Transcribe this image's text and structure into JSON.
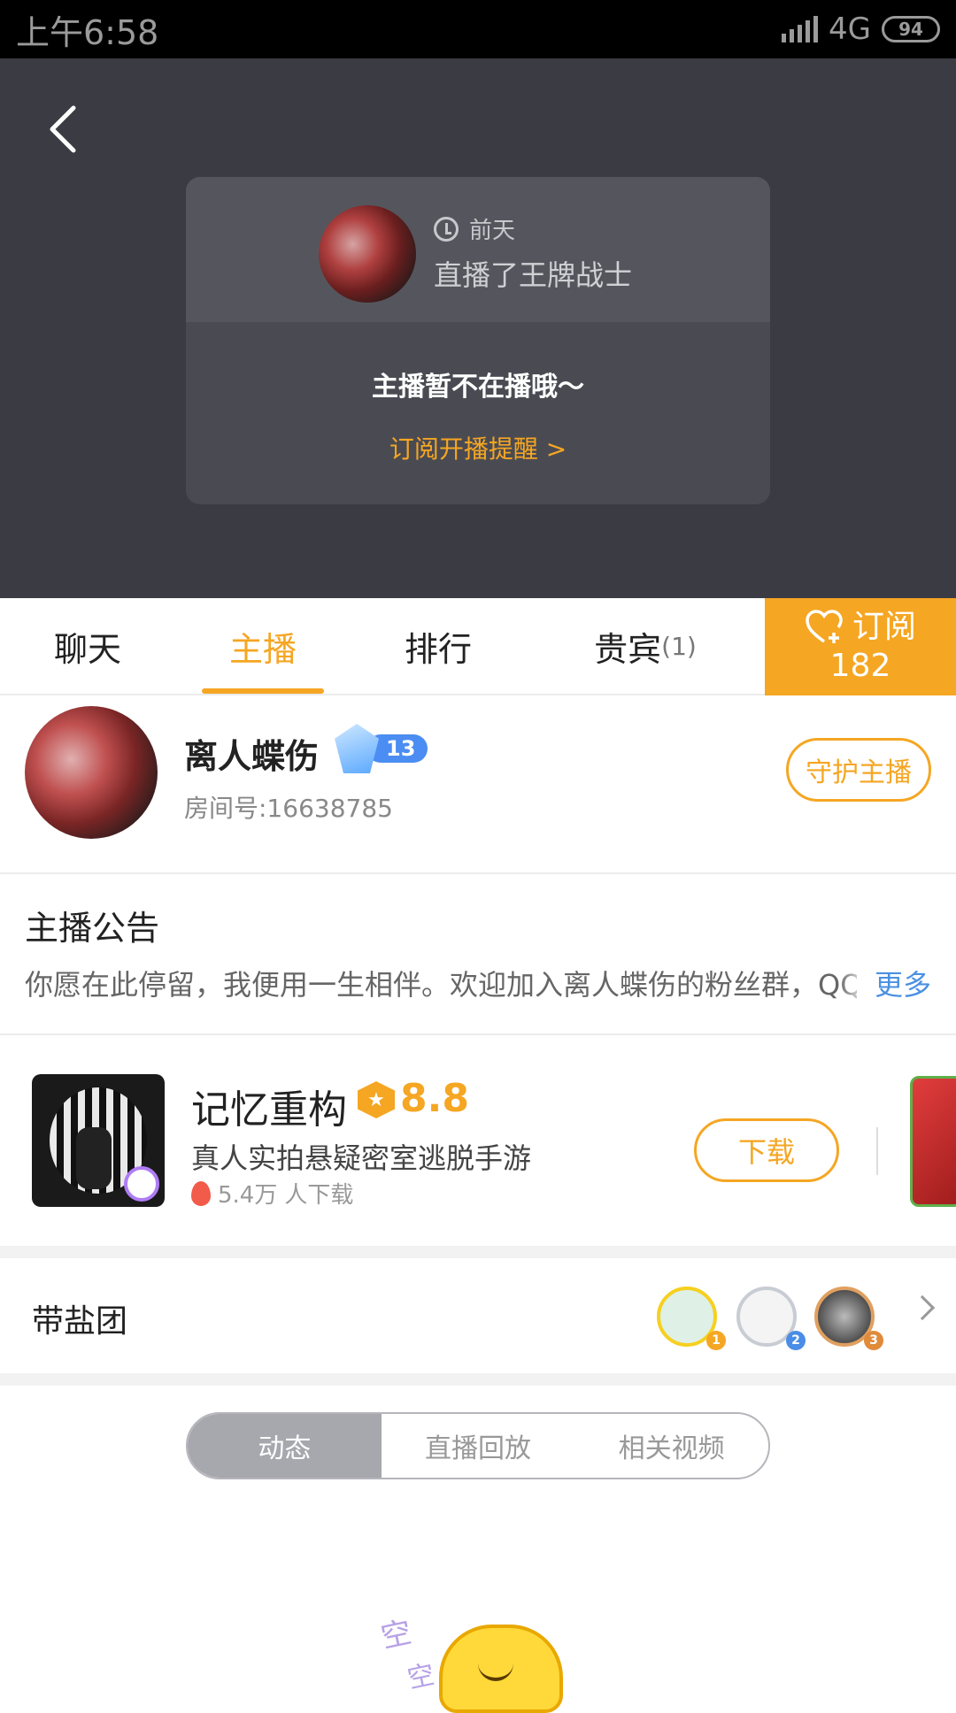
{
  "status_bar": {
    "time": "上午6:58",
    "network": "4G",
    "battery": "94"
  },
  "offline_card": {
    "time_label": "前天",
    "activity": "直播了王牌战士",
    "message": "主播暂不在播哦～",
    "subscribe_link": "订阅开播提醒 >"
  },
  "tabs": [
    {
      "label": "聊天"
    },
    {
      "label": "主播"
    },
    {
      "label": "排行"
    },
    {
      "label": "贵宾",
      "count": "(1)"
    }
  ],
  "subscribe": {
    "label": "订阅",
    "count": "182"
  },
  "streamer": {
    "name": "离人蝶伤",
    "level": "13",
    "room": "房间号:16638785",
    "guard_button": "守护主播"
  },
  "notice": {
    "title": "主播公告",
    "text": "你愿在此停留，我便用一生相伴。欢迎加入离人蝶伤的粉丝群，QQ",
    "more": "更多"
  },
  "game_ad": {
    "title": "记忆重构",
    "score": "8.8",
    "desc": "真人实拍悬疑密室逃脱手游",
    "downloads_count": "5.4万",
    "downloads_suffix": "人下载",
    "button": "下载"
  },
  "fans_group": {
    "title": "带盐团",
    "ranks": [
      "1",
      "2",
      "3"
    ]
  },
  "segment": {
    "items": [
      "动态",
      "直播回放",
      "相关视频"
    ],
    "active_index": 0
  },
  "empty_state": {
    "z1": "空",
    "z2": "空"
  },
  "colors": {
    "accent": "#f5a623",
    "hero_bg": "#3b3c43",
    "link": "#4a90e2"
  }
}
